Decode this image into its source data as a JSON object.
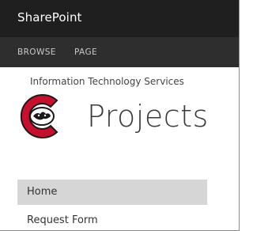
{
  "suite_bar": {
    "brand": "SharePoint"
  },
  "ribbon": {
    "tabs": [
      "BROWSE",
      "PAGE"
    ]
  },
  "site": {
    "breadcrumb": "Information Technology Services",
    "title": "Projects",
    "logo_icon": "university-logo-icon",
    "logo_colors": {
      "red": "#c8102e",
      "dark": "#1a1a1a"
    }
  },
  "quick_launch": {
    "items": [
      {
        "label": "Home",
        "selected": true
      },
      {
        "label": "Request Form",
        "selected": false
      }
    ]
  }
}
